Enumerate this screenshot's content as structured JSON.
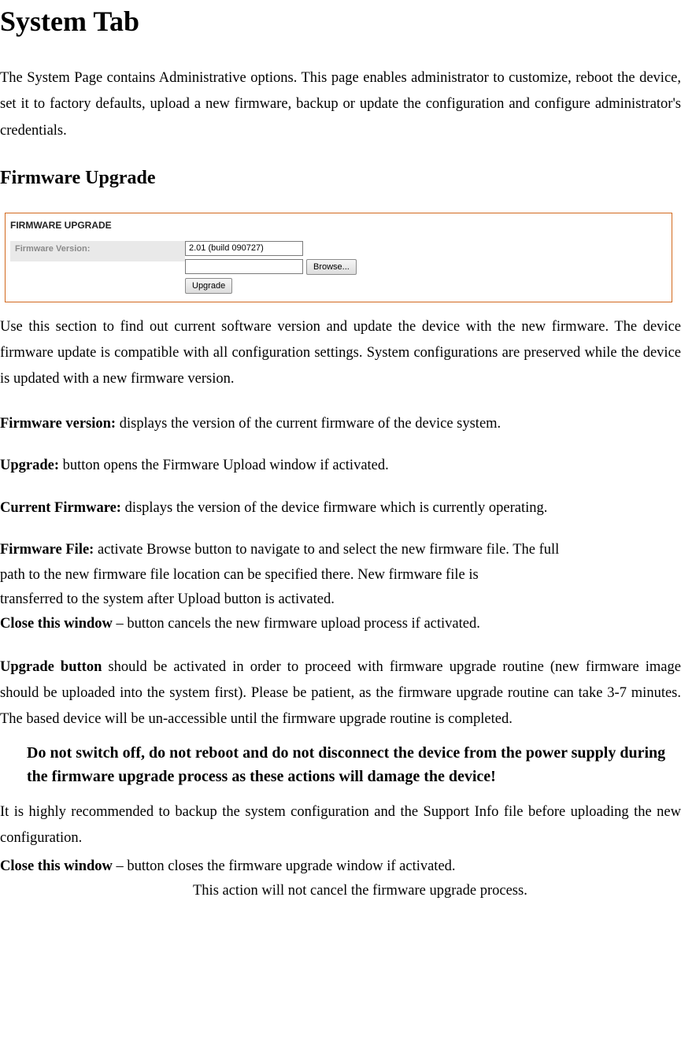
{
  "headings": {
    "main": "System Tab",
    "sub": "Firmware Upgrade"
  },
  "intro_para": "The System Page contains Administrative options. This page enables administrator to customize, reboot the device, set it to factory defaults, upload a new firmware, backup or update the configuration and configure administrator's credentials.",
  "fw_panel": {
    "title": "FIRMWARE UPGRADE",
    "label": "Firmware Version:",
    "version_value": "2.01 (build 090727)",
    "file_value": "",
    "browse_btn": "Browse...",
    "upgrade_btn": "Upgrade"
  },
  "after_panel_para": "Use this section to find out current software version and update the device with the new firmware. The device firmware update is compatible with all configuration settings. System configurations are preserved while the device is updated with a new firmware version.",
  "definitions": {
    "fw_version_label": "Firmware version:",
    "fw_version_text": " displays the version of the current firmware of the device system.",
    "upgrade_label": "Upgrade:",
    "upgrade_text": " button opens the Firmware Upload window if activated.",
    "current_fw_label": "Current Firmware:",
    "current_fw_text": " displays the version of the device firmware which is currently operating.",
    "fw_file_label": "Firmware File:",
    "fw_file_text_line1": " activate Browse button to navigate to and select the new firmware file. The full",
    "fw_file_text_line2": "path to the new firmware file location can be specified there. New firmware file is",
    "fw_file_text_line3": "transferred to the system after Upload button is activated.",
    "close1_label": "Close this window",
    "close1_text": " – button cancels the new firmware upload process if activated."
  },
  "upgrade_para_lead": "Upgrade button",
  "upgrade_para_rest": " should be activated in order to proceed with firmware upgrade routine (new firmware image should be uploaded into the system first). Please be patient, as the firmware upgrade routine can take 3-7 minutes. The based device will be un-accessible until the firmware upgrade routine is completed.",
  "warning_text": "Do not switch off, do not reboot and do not disconnect the device from the power supply during the firmware upgrade process as these actions will damage the device!",
  "backup_para": "It is highly recommended to backup the system configuration and the Support Info file before uploading the new configuration.",
  "close2_label": "Close this window",
  "close2_text": " – button closes the firmware upgrade window if activated.",
  "final_note": "This action will not cancel the firmware upgrade process."
}
